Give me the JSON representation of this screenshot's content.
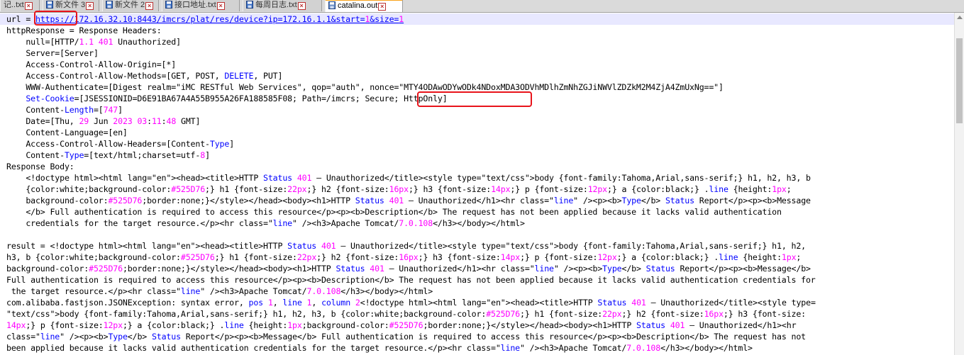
{
  "tabs": [
    {
      "label": "记..txt"
    },
    {
      "label": "新文件 3"
    },
    {
      "label": "新文件 2"
    },
    {
      "label": "接口地址.txt"
    },
    {
      "label": "每周日志.txt"
    },
    {
      "label": "catalina.out"
    }
  ],
  "editor": {
    "lines": [
      "url = https://172.16.32.10:8443/imcrs/plat/res/device?ip=172.16.1.1&start=1&size=1",
      "httpResponse = Response Headers:",
      "    null=[HTTP/1.1 401 Unauthorized]",
      "    Server=[Server]",
      "    Access-Control-Allow-Origin=[*]",
      "    Access-Control-Allow-Methods=[GET, POST, DELETE, PUT]",
      "    WWW-Authenticate=[Digest realm=\"iMC RESTful Web Services\", qop=\"auth\", nonce=\"MTY4ODAwODYwODk4NDoxMDA3ODVhMDlhZmNhZGJiNWVlZDZkM2M4ZjA4ZmUxNg==\"]",
      "    Set-Cookie=[JSESSIONID=D6E91BA67A4A55B955A26FA188585F08; Path=/imcrs; Secure; HttpOnly]",
      "    Content-Length=[747]",
      "    Date=[Thu, 29 Jun 2023 03:11:48 GMT]",
      "    Content-Language=[en]",
      "    Access-Control-Allow-Headers=[Content-Type]",
      "    Content-Type=[text/html;charset=utf-8]",
      "Response Body:",
      "    <!doctype html><html lang=\"en\"><head><title>HTTP Status 401 – Unauthorized</title><style type=\"text/css\">body {font-family:Tahoma,Arial,sans-serif;} h1, h2, h3, b",
      "    {color:white;background-color:#525D76;} h1 {font-size:22px;} h2 {font-size:16px;} h3 {font-size:14px;} p {font-size:12px;} a {color:black;} .line {height:1px;",
      "    background-color:#525D76;border:none;}</style></head><body><h1>HTTP Status 401 – Unauthorized</h1><hr class=\"line\" /><p><b>Type</b> Status Report</p><p><b>Message",
      "    </b> Full authentication is required to access this resource</p><p><b>Description</b> The request has not been applied because it lacks valid authentication",
      "    credentials for the target resource.</p><hr class=\"line\" /><h3>Apache Tomcat/7.0.108</h3></body></html>",
      "",
      "result = <!doctype html><html lang=\"en\"><head><title>HTTP Status 401 – Unauthorized</title><style type=\"text/css\">body {font-family:Tahoma,Arial,sans-serif;} h1, h2,",
      "h3, b {color:white;background-color:#525D76;} h1 {font-size:22px;} h2 {font-size:16px;} h3 {font-size:14px;} p {font-size:12px;} a {color:black;} .line {height:1px;",
      "background-color:#525D76;border:none;}</style></head><body><h1>HTTP Status 401 – Unauthorized</h1><hr class=\"line\" /><p><b>Type</b> Status Report</p><p><b>Message</b>",
      "Full authentication is required to access this resource</p><p><b>Description</b> The request has not been applied because it lacks valid authentication credentials for",
      " the target resource.</p><hr class=\"line\" /><h3>Apache Tomcat/7.0.108</h3></body></html>",
      "com.alibaba.fastjson.JSONException: syntax error, pos 1, line 1, column 2<!doctype html><html lang=\"en\"><head><title>HTTP Status 401 – Unauthorized</title><style type=",
      "\"text/css\">body {font-family:Tahoma,Arial,sans-serif;} h1, h2, h3, b {color:white;background-color:#525D76;} h1 {font-size:22px;} h2 {font-size:16px;} h3 {font-size:",
      "14px;} p {font-size:12px;} a {color:black;} .line {height:1px;background-color:#525D76;border:none;}</style></head><body><h1>HTTP Status 401 – Unauthorized</h1><hr",
      "class=\"line\" /><p><b>Type</b> Status Report</p><p><b>Message</b> Full authentication is required to access this resource</p><p><b>Description</b> The request has not",
      "been applied because it lacks valid authentication credentials for the target resource.</p><hr class=\"line\" /><h3>Apache Tomcat/7.0.108</h3></body></html>"
    ],
    "highlighted_text": [
      "https:",
      "Secure; HttpOnly]"
    ]
  },
  "colors": {
    "highlight_box": "#e8141b",
    "number": "#ff00ff",
    "keyword": "#0000ff",
    "active_tab_accent": "#f9a31a"
  }
}
